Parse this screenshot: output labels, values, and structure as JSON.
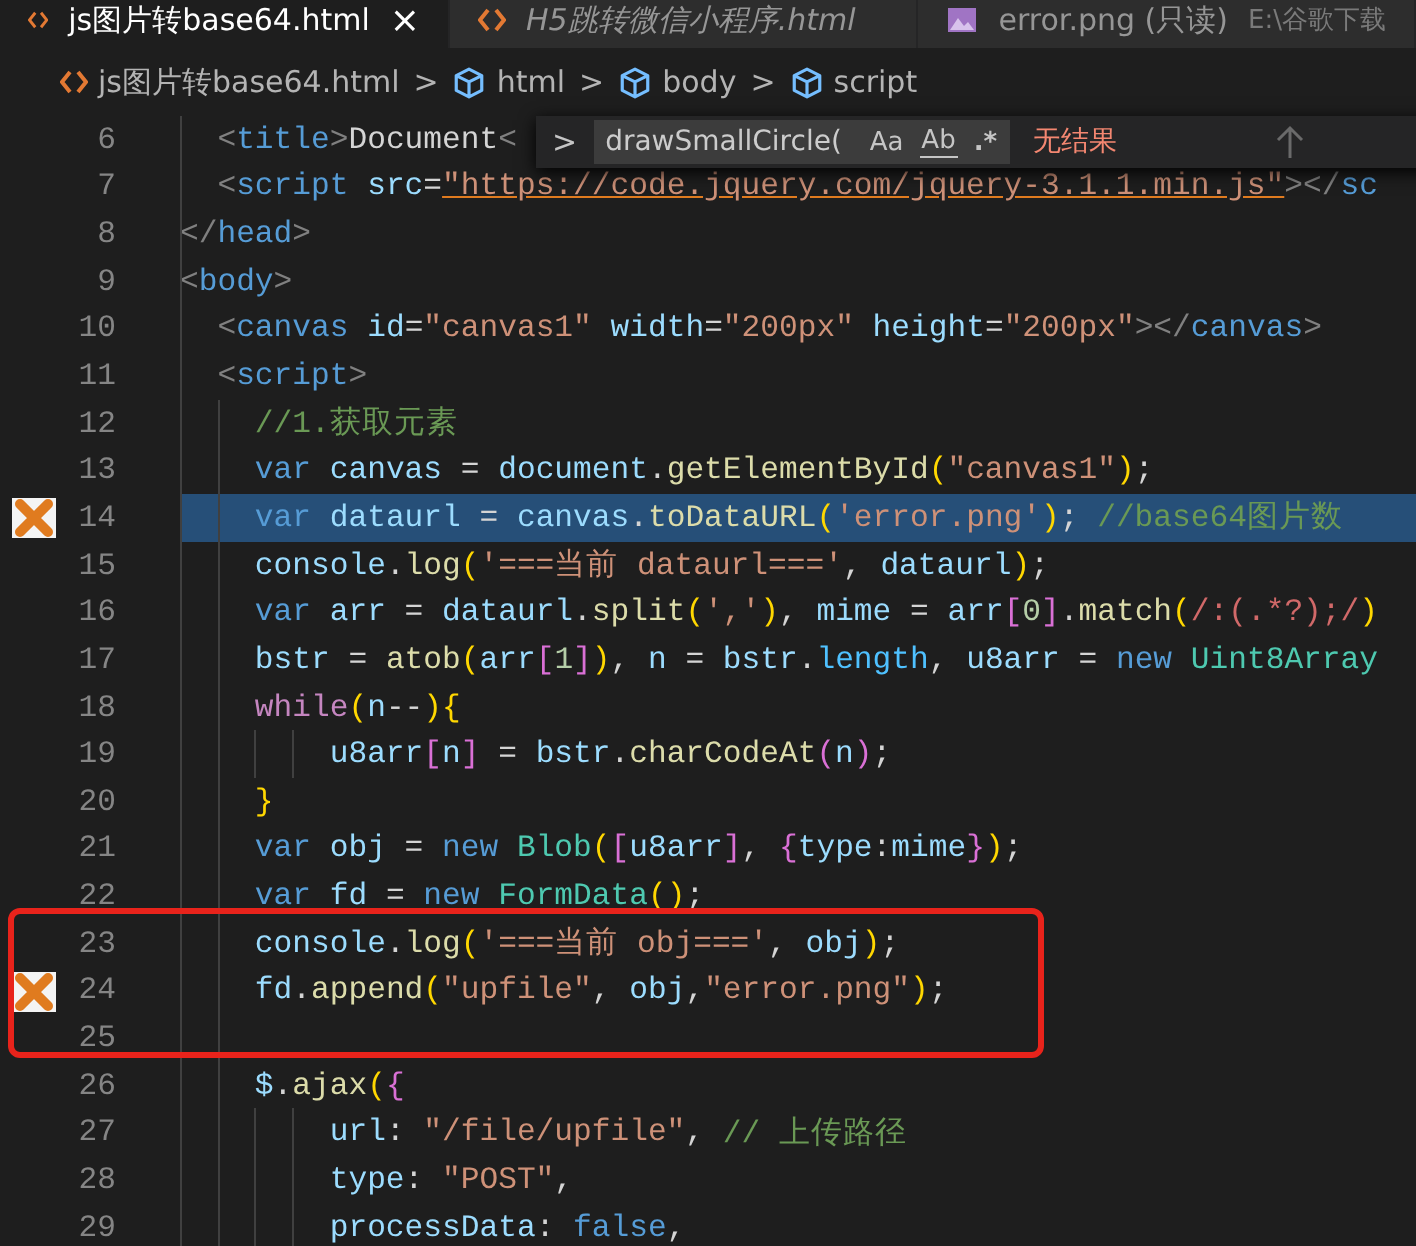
{
  "tabs": [
    {
      "title": "js图片转base64.html",
      "selected": true,
      "preview": false,
      "close": "×"
    },
    {
      "title": "H5跳转微信小程序.html",
      "selected": false,
      "preview": true
    },
    {
      "title": "error.png (只读)",
      "selected": false,
      "preview": false,
      "description": "E:\\谷歌下载"
    }
  ],
  "breadcrumbs": [
    {
      "label": "js图片转base64.html"
    },
    {
      "label": "html"
    },
    {
      "label": "body"
    },
    {
      "label": "script"
    }
  ],
  "breadcrumb_separator": ">",
  "find": {
    "value": "drawSmallCircle(",
    "options": [
      {
        "label": "Aa",
        "kind": "case"
      },
      {
        "label": "Ab",
        "kind": "word"
      },
      {
        "label": ".*",
        "kind": "regex"
      }
    ],
    "result": "无结果",
    "toggle": ">"
  },
  "lines": [
    {
      "number": "6",
      "selected": false,
      "error_mark": false,
      "boxed": false,
      "tokens": [
        {
          "text": "  <",
          "kind": "bracket-tag"
        },
        {
          "text": "title",
          "kind": "tag"
        },
        {
          "text": ">",
          "kind": "bracket-tag"
        },
        {
          "text": "Document",
          "kind": "plain"
        },
        {
          "text": "<",
          "kind": "bracket-tag"
        }
      ]
    },
    {
      "number": "7",
      "selected": false,
      "error_mark": false,
      "boxed": false,
      "tokens": [
        {
          "text": "  <",
          "kind": "bracket-tag"
        },
        {
          "text": "script",
          "kind": "tag"
        },
        {
          "text": " src",
          "kind": "attr"
        },
        {
          "text": "=",
          "kind": "plain"
        },
        {
          "text": "\"https://code.jquery.com/jquery-3.1.1.min.js\"",
          "kind": "link"
        },
        {
          "text": "></",
          "kind": "bracket-tag"
        },
        {
          "text": "sc",
          "kind": "tag"
        }
      ]
    },
    {
      "number": "8",
      "selected": false,
      "error_mark": false,
      "boxed": false,
      "tokens": [
        {
          "text": "</",
          "kind": "bracket-tag"
        },
        {
          "text": "head",
          "kind": "tag"
        },
        {
          "text": ">",
          "kind": "bracket-tag"
        }
      ]
    },
    {
      "number": "9",
      "selected": false,
      "error_mark": false,
      "boxed": false,
      "tokens": [
        {
          "text": "<",
          "kind": "bracket-tag"
        },
        {
          "text": "body",
          "kind": "tag"
        },
        {
          "text": ">",
          "kind": "bracket-tag"
        }
      ]
    },
    {
      "number": "10",
      "selected": false,
      "error_mark": false,
      "boxed": false,
      "tokens": [
        {
          "text": "  <",
          "kind": "bracket-tag"
        },
        {
          "text": "canvas",
          "kind": "tag"
        },
        {
          "text": " id",
          "kind": "attr"
        },
        {
          "text": "=",
          "kind": "plain"
        },
        {
          "text": "\"canvas1\"",
          "kind": "string"
        },
        {
          "text": " width",
          "kind": "attr"
        },
        {
          "text": "=",
          "kind": "plain"
        },
        {
          "text": "\"200px\"",
          "kind": "string"
        },
        {
          "text": " height",
          "kind": "attr"
        },
        {
          "text": "=",
          "kind": "plain"
        },
        {
          "text": "\"200px\"",
          "kind": "string"
        },
        {
          "text": "></",
          "kind": "bracket-tag"
        },
        {
          "text": "canvas",
          "kind": "tag"
        },
        {
          "text": ">",
          "kind": "bracket-tag"
        }
      ]
    },
    {
      "number": "11",
      "selected": false,
      "error_mark": false,
      "boxed": false,
      "tokens": [
        {
          "text": "  <",
          "kind": "bracket-tag"
        },
        {
          "text": "script",
          "kind": "tag"
        },
        {
          "text": ">",
          "kind": "bracket-tag"
        }
      ]
    },
    {
      "number": "12",
      "selected": false,
      "error_mark": false,
      "boxed": false,
      "tokens": [
        {
          "text": "    //1.获取元素",
          "kind": "comment"
        }
      ]
    },
    {
      "number": "13",
      "selected": false,
      "error_mark": false,
      "boxed": false,
      "tokens": [
        {
          "text": "    var",
          "kind": "keyword"
        },
        {
          "text": " canvas",
          "kind": "variable"
        },
        {
          "text": " = ",
          "kind": "plain"
        },
        {
          "text": "document",
          "kind": "variable"
        },
        {
          "text": ".",
          "kind": "plain"
        },
        {
          "text": "getElementById",
          "kind": "function"
        },
        {
          "text": "(",
          "kind": "bracket-1"
        },
        {
          "text": "\"canvas1\"",
          "kind": "string"
        },
        {
          "text": ")",
          "kind": "bracket-1"
        },
        {
          "text": ";",
          "kind": "plain"
        }
      ]
    },
    {
      "number": "14",
      "selected": true,
      "error_mark": true,
      "boxed": false,
      "tokens": [
        {
          "text": "    var",
          "kind": "keyword"
        },
        {
          "text": " dataurl",
          "kind": "variable"
        },
        {
          "text": " = ",
          "kind": "plain"
        },
        {
          "text": "canvas",
          "kind": "variable"
        },
        {
          "text": ".",
          "kind": "plain"
        },
        {
          "text": "toDataURL",
          "kind": "function"
        },
        {
          "text": "(",
          "kind": "bracket-1"
        },
        {
          "text": "'error.png'",
          "kind": "string"
        },
        {
          "text": ")",
          "kind": "bracket-1"
        },
        {
          "text": "; ",
          "kind": "plain"
        },
        {
          "text": "//base64图片数",
          "kind": "comment"
        }
      ]
    },
    {
      "number": "15",
      "selected": false,
      "error_mark": false,
      "boxed": false,
      "tokens": [
        {
          "text": "    console",
          "kind": "variable"
        },
        {
          "text": ".",
          "kind": "plain"
        },
        {
          "text": "log",
          "kind": "function"
        },
        {
          "text": "(",
          "kind": "bracket-1"
        },
        {
          "text": "'===当前 dataurl==='",
          "kind": "string"
        },
        {
          "text": ", ",
          "kind": "plain"
        },
        {
          "text": "dataurl",
          "kind": "variable"
        },
        {
          "text": ")",
          "kind": "bracket-1"
        },
        {
          "text": ";",
          "kind": "plain"
        }
      ]
    },
    {
      "number": "16",
      "selected": false,
      "error_mark": false,
      "boxed": false,
      "tokens": [
        {
          "text": "    var",
          "kind": "keyword"
        },
        {
          "text": " arr",
          "kind": "variable"
        },
        {
          "text": " = ",
          "kind": "plain"
        },
        {
          "text": "dataurl",
          "kind": "variable"
        },
        {
          "text": ".",
          "kind": "plain"
        },
        {
          "text": "split",
          "kind": "function"
        },
        {
          "text": "(",
          "kind": "bracket-1"
        },
        {
          "text": "','",
          "kind": "string"
        },
        {
          "text": ")",
          "kind": "bracket-1"
        },
        {
          "text": ", ",
          "kind": "plain"
        },
        {
          "text": "mime",
          "kind": "variable"
        },
        {
          "text": " = ",
          "kind": "plain"
        },
        {
          "text": "arr",
          "kind": "variable"
        },
        {
          "text": "[",
          "kind": "bracket-2"
        },
        {
          "text": "0",
          "kind": "number"
        },
        {
          "text": "]",
          "kind": "bracket-2"
        },
        {
          "text": ".",
          "kind": "plain"
        },
        {
          "text": "match",
          "kind": "function"
        },
        {
          "text": "(",
          "kind": "bracket-1"
        },
        {
          "text": "/:(.*?);/",
          "kind": "regex"
        },
        {
          "text": ")",
          "kind": "bracket-1"
        }
      ]
    },
    {
      "number": "17",
      "selected": false,
      "error_mark": false,
      "boxed": false,
      "tokens": [
        {
          "text": "    bstr",
          "kind": "variable"
        },
        {
          "text": " = ",
          "kind": "plain"
        },
        {
          "text": "atob",
          "kind": "function"
        },
        {
          "text": "(",
          "kind": "bracket-1"
        },
        {
          "text": "arr",
          "kind": "variable"
        },
        {
          "text": "[",
          "kind": "bracket-2"
        },
        {
          "text": "1",
          "kind": "number"
        },
        {
          "text": "]",
          "kind": "bracket-2"
        },
        {
          "text": ")",
          "kind": "bracket-1"
        },
        {
          "text": ", ",
          "kind": "plain"
        },
        {
          "text": "n",
          "kind": "variable"
        },
        {
          "text": " = ",
          "kind": "plain"
        },
        {
          "text": "bstr",
          "kind": "variable"
        },
        {
          "text": ".",
          "kind": "plain"
        },
        {
          "text": "length",
          "kind": "property"
        },
        {
          "text": ", ",
          "kind": "plain"
        },
        {
          "text": "u8arr",
          "kind": "variable"
        },
        {
          "text": " = ",
          "kind": "plain"
        },
        {
          "text": "new",
          "kind": "keyword"
        },
        {
          "text": " Uint8Array",
          "kind": "class"
        }
      ]
    },
    {
      "number": "18",
      "selected": false,
      "error_mark": false,
      "boxed": false,
      "tokens": [
        {
          "text": "    while",
          "kind": "control"
        },
        {
          "text": "(",
          "kind": "bracket-1"
        },
        {
          "text": "n",
          "kind": "variable"
        },
        {
          "text": "--",
          "kind": "plain"
        },
        {
          "text": ")",
          "kind": "bracket-1"
        },
        {
          "text": "{",
          "kind": "bracket-1"
        }
      ]
    },
    {
      "number": "19",
      "selected": false,
      "error_mark": false,
      "boxed": false,
      "tokens": [
        {
          "text": "        u8arr",
          "kind": "variable"
        },
        {
          "text": "[",
          "kind": "bracket-2"
        },
        {
          "text": "n",
          "kind": "variable"
        },
        {
          "text": "]",
          "kind": "bracket-2"
        },
        {
          "text": " = ",
          "kind": "plain"
        },
        {
          "text": "bstr",
          "kind": "variable"
        },
        {
          "text": ".",
          "kind": "plain"
        },
        {
          "text": "charCodeAt",
          "kind": "function"
        },
        {
          "text": "(",
          "kind": "bracket-2"
        },
        {
          "text": "n",
          "kind": "variable"
        },
        {
          "text": ")",
          "kind": "bracket-2"
        },
        {
          "text": ";",
          "kind": "plain"
        }
      ]
    },
    {
      "number": "20",
      "selected": false,
      "error_mark": false,
      "boxed": false,
      "tokens": [
        {
          "text": "    }",
          "kind": "bracket-1"
        }
      ]
    },
    {
      "number": "21",
      "selected": false,
      "error_mark": false,
      "boxed": false,
      "tokens": [
        {
          "text": "    var",
          "kind": "keyword"
        },
        {
          "text": " obj",
          "kind": "variable"
        },
        {
          "text": " = ",
          "kind": "plain"
        },
        {
          "text": "new",
          "kind": "keyword"
        },
        {
          "text": " Blob",
          "kind": "class"
        },
        {
          "text": "(",
          "kind": "bracket-1"
        },
        {
          "text": "[",
          "kind": "bracket-2"
        },
        {
          "text": "u8arr",
          "kind": "variable"
        },
        {
          "text": "]",
          "kind": "bracket-2"
        },
        {
          "text": ", ",
          "kind": "plain"
        },
        {
          "text": "{",
          "kind": "bracket-2"
        },
        {
          "text": "type",
          "kind": "variable"
        },
        {
          "text": ":",
          "kind": "plain"
        },
        {
          "text": "mime",
          "kind": "variable"
        },
        {
          "text": "}",
          "kind": "bracket-2"
        },
        {
          "text": ")",
          "kind": "bracket-1"
        },
        {
          "text": ";",
          "kind": "plain"
        }
      ]
    },
    {
      "number": "22",
      "selected": false,
      "error_mark": false,
      "boxed": false,
      "tokens": [
        {
          "text": "    var",
          "kind": "keyword"
        },
        {
          "text": " fd",
          "kind": "variable"
        },
        {
          "text": " = ",
          "kind": "plain"
        },
        {
          "text": "new",
          "kind": "keyword"
        },
        {
          "text": " FormData",
          "kind": "class"
        },
        {
          "text": "(",
          "kind": "bracket-1"
        },
        {
          "text": ")",
          "kind": "bracket-1"
        },
        {
          "text": ";",
          "kind": "plain"
        }
      ]
    },
    {
      "number": "23",
      "selected": false,
      "error_mark": false,
      "boxed": true,
      "tokens": [
        {
          "text": "    console",
          "kind": "variable"
        },
        {
          "text": ".",
          "kind": "plain"
        },
        {
          "text": "log",
          "kind": "function"
        },
        {
          "text": "(",
          "kind": "bracket-1"
        },
        {
          "text": "'===当前 obj==='",
          "kind": "string"
        },
        {
          "text": ", ",
          "kind": "plain"
        },
        {
          "text": "obj",
          "kind": "variable"
        },
        {
          "text": ")",
          "kind": "bracket-1"
        },
        {
          "text": ";",
          "kind": "plain"
        }
      ]
    },
    {
      "number": "24",
      "selected": false,
      "error_mark": true,
      "boxed": true,
      "tokens": [
        {
          "text": "    fd",
          "kind": "variable"
        },
        {
          "text": ".",
          "kind": "plain"
        },
        {
          "text": "append",
          "kind": "function"
        },
        {
          "text": "(",
          "kind": "bracket-1"
        },
        {
          "text": "\"upfile\"",
          "kind": "string"
        },
        {
          "text": ", ",
          "kind": "plain"
        },
        {
          "text": "obj",
          "kind": "variable"
        },
        {
          "text": ",",
          "kind": "plain"
        },
        {
          "text": "\"error.png\"",
          "kind": "string"
        },
        {
          "text": ")",
          "kind": "bracket-1"
        },
        {
          "text": ";",
          "kind": "plain"
        }
      ]
    },
    {
      "number": "25",
      "selected": false,
      "error_mark": false,
      "boxed": true
    },
    {
      "number": "26",
      "selected": false,
      "error_mark": false,
      "boxed": false,
      "tokens": [
        {
          "text": "    $",
          "kind": "variable"
        },
        {
          "text": ".",
          "kind": "plain"
        },
        {
          "text": "ajax",
          "kind": "function"
        },
        {
          "text": "(",
          "kind": "bracket-1"
        },
        {
          "text": "{",
          "kind": "bracket-2"
        }
      ]
    },
    {
      "number": "27",
      "selected": false,
      "error_mark": false,
      "boxed": false,
      "tokens": [
        {
          "text": "        url",
          "kind": "variable"
        },
        {
          "text": ": ",
          "kind": "plain"
        },
        {
          "text": "\"/file/upfile\"",
          "kind": "string"
        },
        {
          "text": ", ",
          "kind": "plain"
        },
        {
          "text": "// 上传路径",
          "kind": "comment"
        }
      ]
    },
    {
      "number": "28",
      "selected": false,
      "error_mark": false,
      "boxed": false,
      "tokens": [
        {
          "text": "        type",
          "kind": "variable"
        },
        {
          "text": ": ",
          "kind": "plain"
        },
        {
          "text": "\"POST\"",
          "kind": "string"
        },
        {
          "text": ",",
          "kind": "plain"
        }
      ]
    },
    {
      "number": "29",
      "selected": false,
      "error_mark": false,
      "boxed": false,
      "tokens": [
        {
          "text": "        processData",
          "kind": "variable"
        },
        {
          "text": ": ",
          "kind": "plain"
        },
        {
          "text": "false",
          "kind": "keyword"
        },
        {
          "text": ",",
          "kind": "plain"
        }
      ]
    }
  ]
}
